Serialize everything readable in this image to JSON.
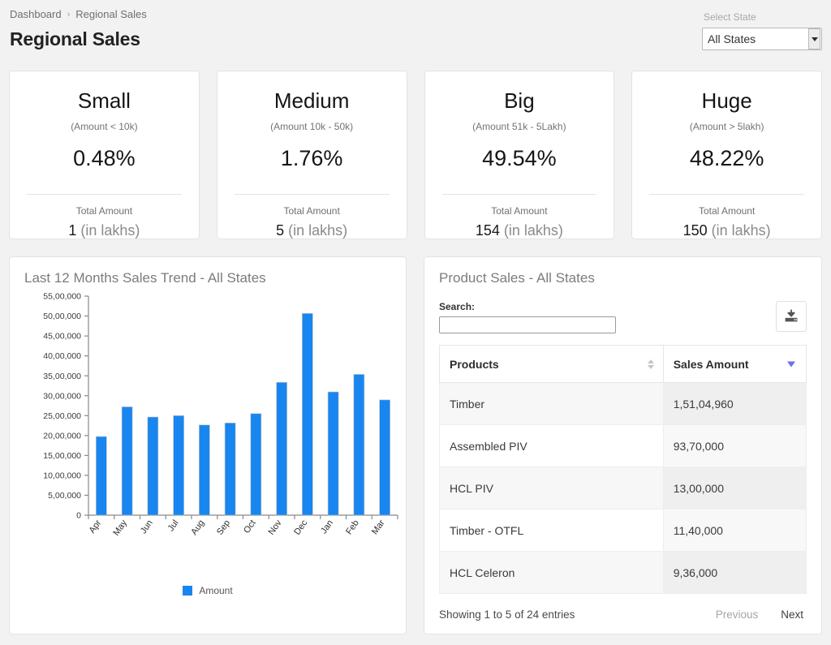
{
  "breadcrumb": {
    "parent": "Dashboard",
    "separator": "›",
    "current": "Regional Sales"
  },
  "header": {
    "title": "Regional Sales"
  },
  "state_filter": {
    "label": "Select State",
    "selected": "All States",
    "options": [
      "All States"
    ],
    "chevron_icon": "chevron-down-icon"
  },
  "kpis": [
    {
      "title": "Small",
      "subtitle": "(Amount < 10k)",
      "percent": "0.48%",
      "total_label": "Total Amount",
      "total_value": "1",
      "total_unit": " (in lakhs)"
    },
    {
      "title": "Medium",
      "subtitle": "(Amount 10k - 50k)",
      "percent": "1.76%",
      "total_label": "Total Amount",
      "total_value": "5",
      "total_unit": " (in lakhs)"
    },
    {
      "title": "Big",
      "subtitle": "(Amount 51k - 5Lakh)",
      "percent": "49.54%",
      "total_label": "Total Amount",
      "total_value": "154",
      "total_unit": " (in lakhs)"
    },
    {
      "title": "Huge",
      "subtitle": "(Amount > 5lakh)",
      "percent": "48.22%",
      "total_label": "Total Amount",
      "total_value": "150",
      "total_unit": " (in lakhs)"
    }
  ],
  "trend_panel": {
    "title": "Last 12 Months Sales Trend - All States"
  },
  "chart_data": {
    "type": "bar",
    "title": "Last 12 Months Sales Trend - All States",
    "xlabel": "",
    "ylabel": "",
    "categories": [
      "Apr",
      "May",
      "Jun",
      "Jul",
      "Aug",
      "Sep",
      "Oct",
      "Nov",
      "Dec",
      "Jan",
      "Feb",
      "Mar"
    ],
    "values": [
      1975000,
      2720000,
      2465000,
      2500000,
      2265000,
      2315000,
      2550000,
      3335000,
      5065000,
      3095000,
      3535000,
      2895000
    ],
    "series": [
      {
        "name": "Amount",
        "color": "#1886f0",
        "values": [
          1975000,
          2720000,
          2465000,
          2500000,
          2265000,
          2315000,
          2550000,
          3335000,
          5065000,
          3095000,
          3535000,
          2895000
        ]
      }
    ],
    "ylim": [
      0,
      5500000
    ],
    "ytick_step": 500000,
    "ytick_labels": [
      "0",
      "5,00,000",
      "10,00,000",
      "15,00,000",
      "20,00,000",
      "25,00,000",
      "30,00,000",
      "35,00,000",
      "40,00,000",
      "45,00,000",
      "50,00,000",
      "55,00,000"
    ],
    "grid": false,
    "legend": {
      "position": "bottom",
      "entries": [
        "Amount"
      ]
    },
    "bar_color": "#1886f0"
  },
  "product_panel": {
    "title": "Product Sales - All States",
    "search_label": "Search:",
    "search_value": "",
    "search_placeholder": "",
    "export_icon": "download-icon",
    "columns": [
      {
        "label": "Products",
        "sort_icon": "sort-both-icon",
        "sorted": false
      },
      {
        "label": "Sales Amount",
        "sort_icon": "sort-desc-icon",
        "sorted": true
      }
    ],
    "rows": [
      {
        "product": "Timber",
        "amount": "1,51,04,960"
      },
      {
        "product": "Assembled PIV",
        "amount": "93,70,000"
      },
      {
        "product": "HCL PIV",
        "amount": "13,00,000"
      },
      {
        "product": "Timber - OTFL",
        "amount": "11,40,000"
      },
      {
        "product": "HCL Celeron",
        "amount": "9,36,000"
      }
    ],
    "footer": {
      "entries_info": "Showing 1 to 5 of 24 entries",
      "previous": "Previous",
      "next": "Next"
    }
  },
  "colors": {
    "accent": "#1886f0",
    "background": "#f2f2f2",
    "card": "#ffffff",
    "sort_active": "#6a72e8"
  }
}
